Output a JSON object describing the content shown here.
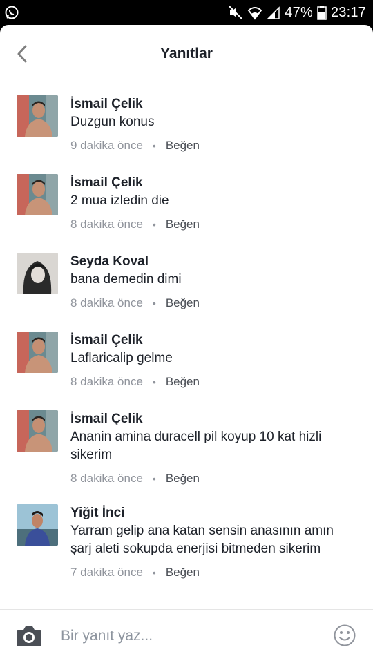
{
  "status_bar": {
    "battery": "47%",
    "time": "23:17"
  },
  "header": {
    "title": "Yanıtlar"
  },
  "comments": [
    {
      "name": "İsmail Çelik",
      "text": "Duzgun konus",
      "time": "9 dakika önce",
      "like": "Beğen"
    },
    {
      "name": "İsmail Çelik",
      "text": "2 mua izledin die",
      "time": "8 dakika önce",
      "like": "Beğen"
    },
    {
      "name": "Seyda Koval",
      "text": "bana demedin dimi",
      "time": "8 dakika önce",
      "like": "Beğen"
    },
    {
      "name": "İsmail Çelik",
      "text": "Laflaricalip gelme",
      "time": "8 dakika önce",
      "like": "Beğen"
    },
    {
      "name": "İsmail Çelik",
      "text": "Ananin amina duracell pil koyup 10 kat hizli sikerim",
      "time": "8 dakika önce",
      "like": "Beğen"
    },
    {
      "name": "Yiğit İnci",
      "text": "Yarram gelip ana katan sensin anasının amın şarj aleti sokupda enerjisi bitmeden sikerim",
      "time": "7 dakika önce",
      "like": "Beğen"
    }
  ],
  "composer": {
    "placeholder": "Bir yanıt yaz..."
  }
}
